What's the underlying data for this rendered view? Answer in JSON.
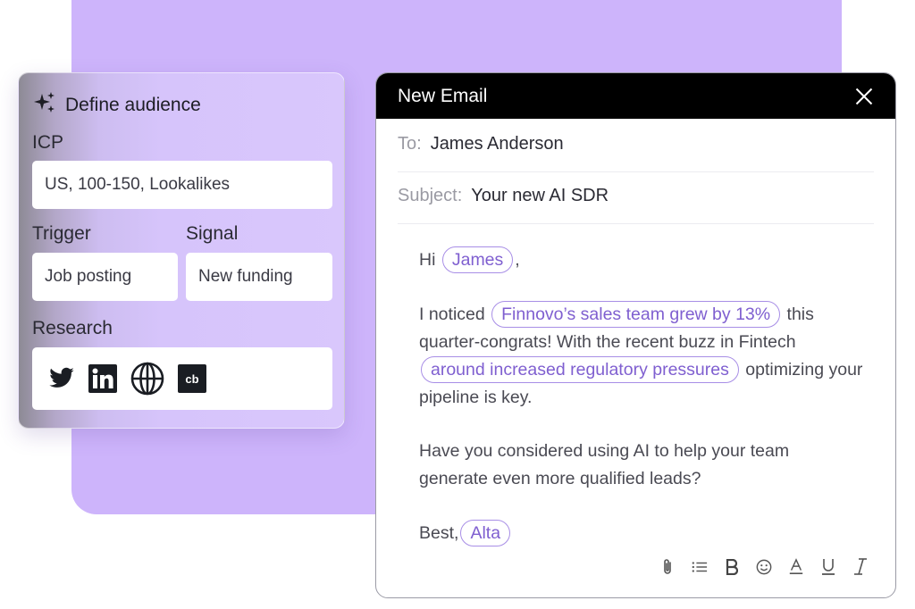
{
  "audience": {
    "title": "Define audience",
    "icp_label": "ICP",
    "icp_value": "US, 100-150, Lookalikes",
    "trigger_label": "Trigger",
    "trigger_value": "Job posting",
    "signal_label": "Signal",
    "signal_value": "New funding",
    "research_label": "Research",
    "research_icons": [
      "twitter-icon",
      "linkedin-icon",
      "globe-icon",
      "crunchbase-icon"
    ],
    "crunchbase_text": "cb"
  },
  "email": {
    "header_title": "New Email",
    "to_label": "To:",
    "to_value": "James Anderson",
    "subject_label": "Subject:",
    "subject_value": "Your new AI SDR",
    "greeting_prefix": "Hi",
    "greeting_name": "James",
    "greeting_suffix": ",",
    "p1_start": "I noticed",
    "p1_pill1": "Finnovo’s sales team grew by 13%",
    "p1_mid": "this quarter-congrats! With the recent buzz in Fintech",
    "p1_pill2": "around increased regulatory pressures",
    "p1_end": "optimizing your pipeline is key.",
    "p2": "Have you considered using AI to help your team generate even more qualified leads?",
    "signoff": "Best,",
    "signoff_name": "Alta",
    "toolbar": [
      "attach-icon",
      "list-icon",
      "bold-icon",
      "emoji-icon",
      "text-color-icon",
      "underline-icon",
      "italic-icon"
    ]
  },
  "colors": {
    "background_panel": "#cdb4fb",
    "pill_border": "#a88ee6",
    "pill_text": "#7f5fd0",
    "header_bg": "#000000"
  }
}
